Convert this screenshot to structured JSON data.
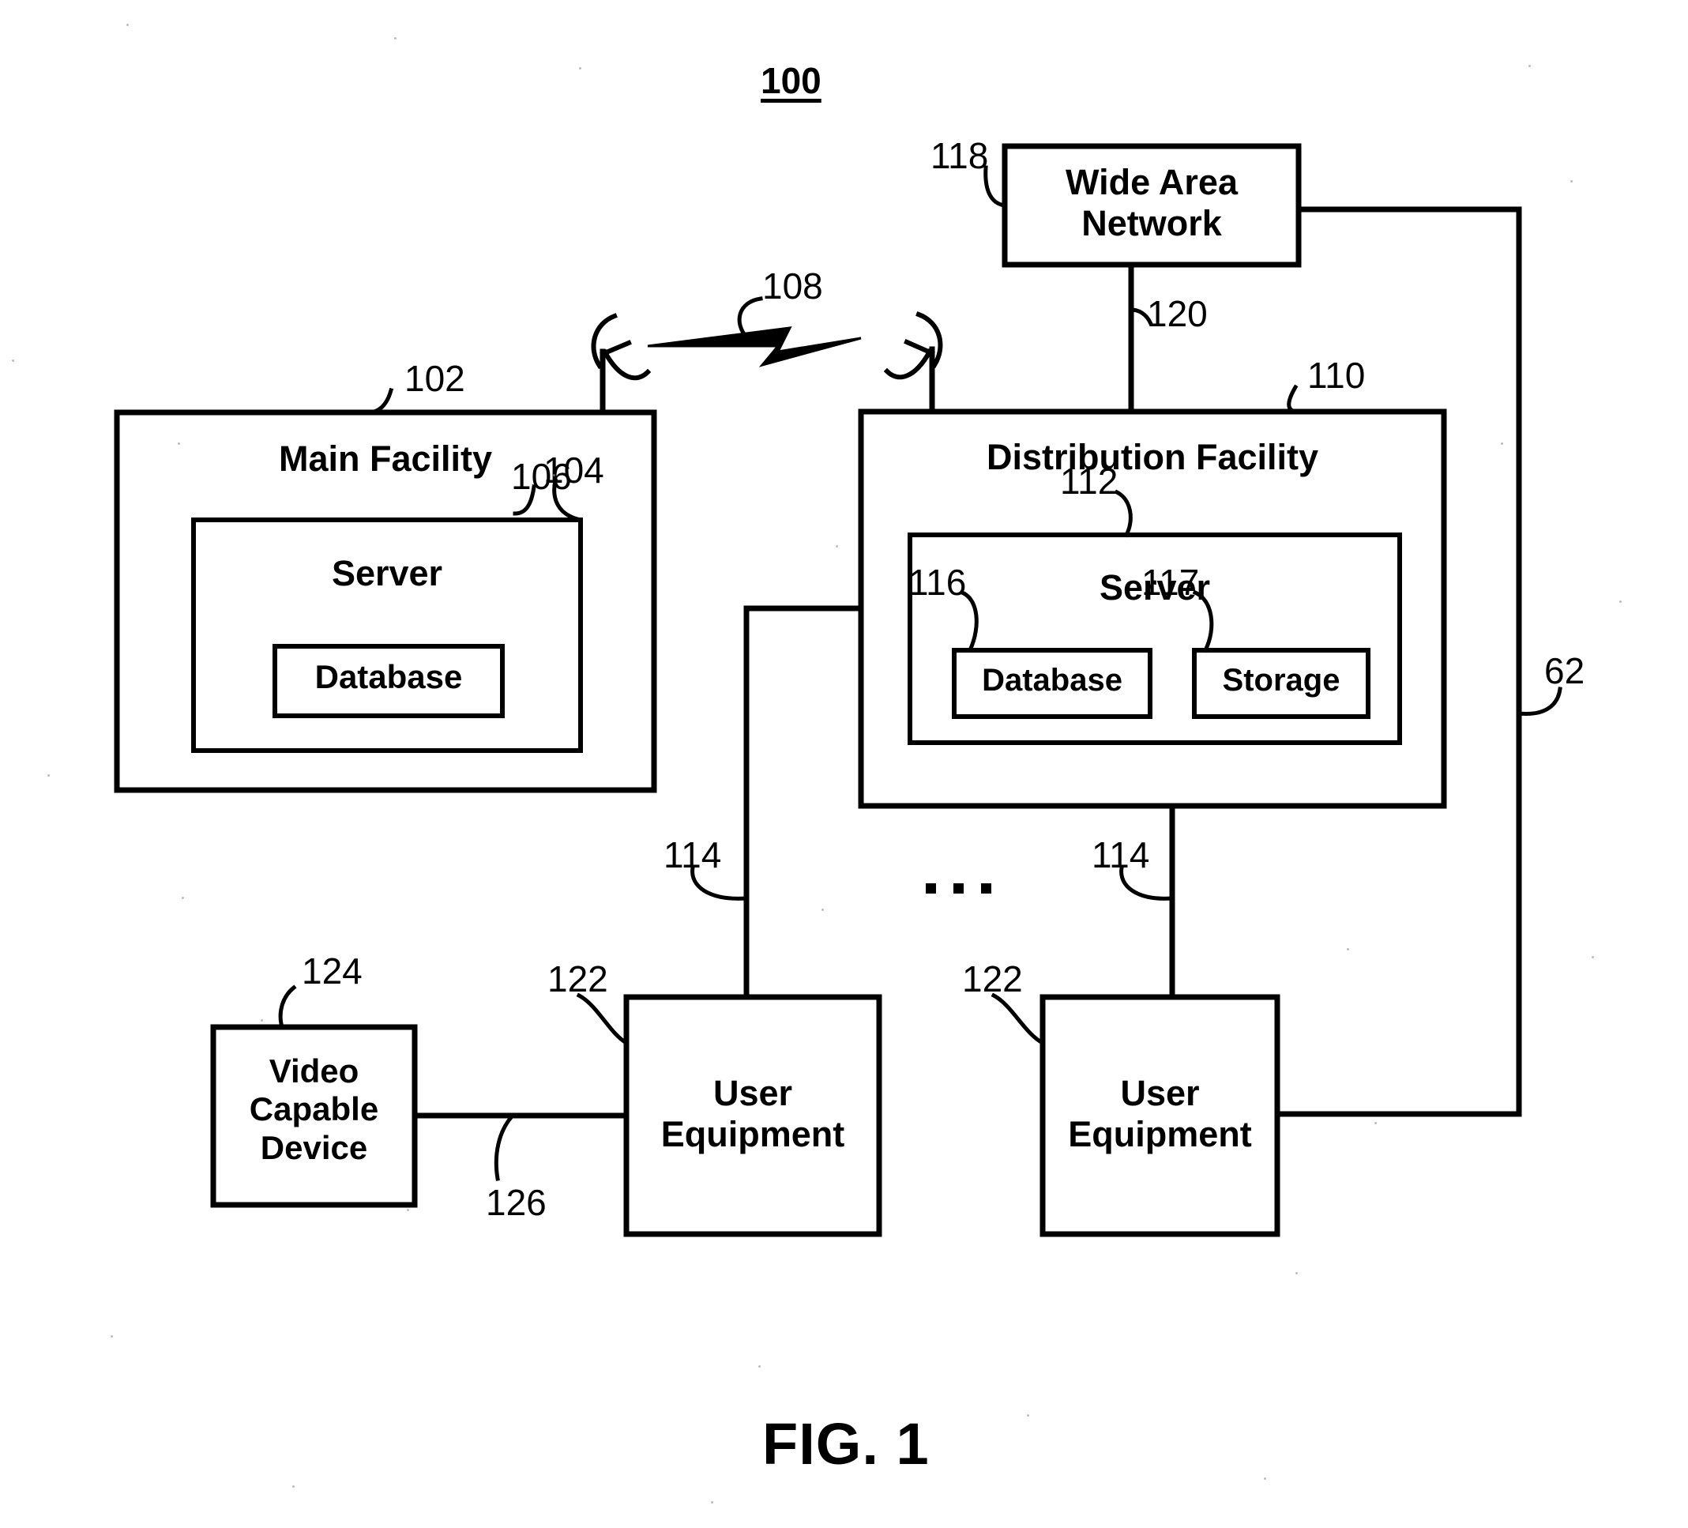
{
  "figure": {
    "number_label": "100",
    "caption": "FIG. 1"
  },
  "nodes": {
    "wide_area_network": {
      "label": "Wide Area\nNetwork",
      "ref": "118"
    },
    "main_facility": {
      "label": "Main Facility",
      "ref": "102"
    },
    "main_server": {
      "label": "Server",
      "ref": "104"
    },
    "main_database": {
      "label": "Database",
      "ref": "106"
    },
    "distribution_facility": {
      "label": "Distribution Facility",
      "ref": "110"
    },
    "dist_server": {
      "label": "Server",
      "ref": "112"
    },
    "dist_database": {
      "label": "Database",
      "ref": "116"
    },
    "dist_storage": {
      "label": "Storage",
      "ref": "117"
    },
    "user_equipment_left": {
      "label": "User\nEquipment",
      "ref": "122"
    },
    "user_equipment_right": {
      "label": "User\nEquipment",
      "ref": "122"
    },
    "video_capable_device": {
      "label": "Video\nCapable\nDevice",
      "ref": "124"
    }
  },
  "links": {
    "wireless_link": {
      "ref": "108"
    },
    "wan_to_distribution": {
      "ref": "120"
    },
    "distribution_to_ue_left": {
      "ref": "114"
    },
    "distribution_to_ue_right": {
      "ref": "114"
    },
    "device_to_ue": {
      "ref": "126"
    },
    "wan_to_ue_right": {
      "ref": "62"
    }
  },
  "ellipsis": "...",
  "colors": {
    "stroke": "#000000",
    "background": "#ffffff"
  }
}
